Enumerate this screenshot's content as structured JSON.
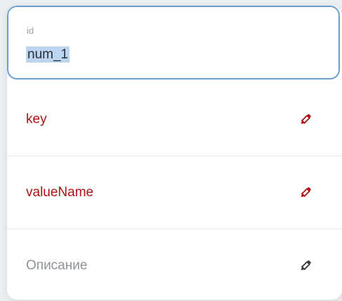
{
  "id_field": {
    "label": "id",
    "value": "num_1"
  },
  "rows": [
    {
      "label": "key",
      "color": "#b01212",
      "icon": "pencil-icon"
    },
    {
      "label": "valueName",
      "color": "#b01212",
      "icon": "pencil-icon"
    },
    {
      "label": "Описание",
      "color": "#8e9499",
      "icon": "pencil-icon"
    }
  ],
  "colors": {
    "focus_border": "#6aa0d6",
    "selection": "#bcd5f0",
    "required_label": "#b01212",
    "optional_label": "#8e9499",
    "icon_dark": "#3a3a3a"
  }
}
